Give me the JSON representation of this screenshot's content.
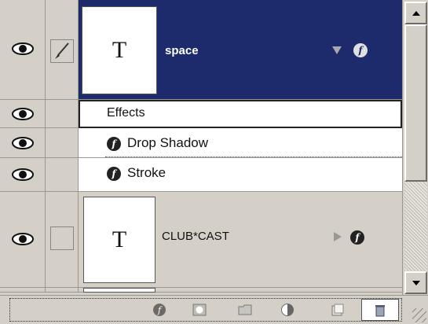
{
  "layers": [
    {
      "name": "space",
      "thumb_glyph": "T",
      "selected": true
    },
    {
      "name": "CLUB*CAST",
      "thumb_glyph": "T",
      "selected": false
    }
  ],
  "effects": {
    "header": "Effects",
    "items": [
      {
        "label": "Drop Shadow"
      },
      {
        "label": "Stroke"
      }
    ]
  },
  "icons": {
    "visibility": "eye-icon",
    "link": "paintbrush-icon",
    "fx": "fx-icon",
    "expanded": "triangle-down-icon",
    "collapsed": "triangle-right-icon"
  },
  "colors": {
    "selected_row": "#1d2a6b",
    "panel_bg": "#d4d0c8",
    "effects_bg": "#ffffff"
  },
  "toolbar": {
    "buttons": [
      "add-layer-style",
      "add-mask",
      "new-group",
      "new-adjustment-layer",
      "new-layer",
      "delete-layer"
    ]
  }
}
